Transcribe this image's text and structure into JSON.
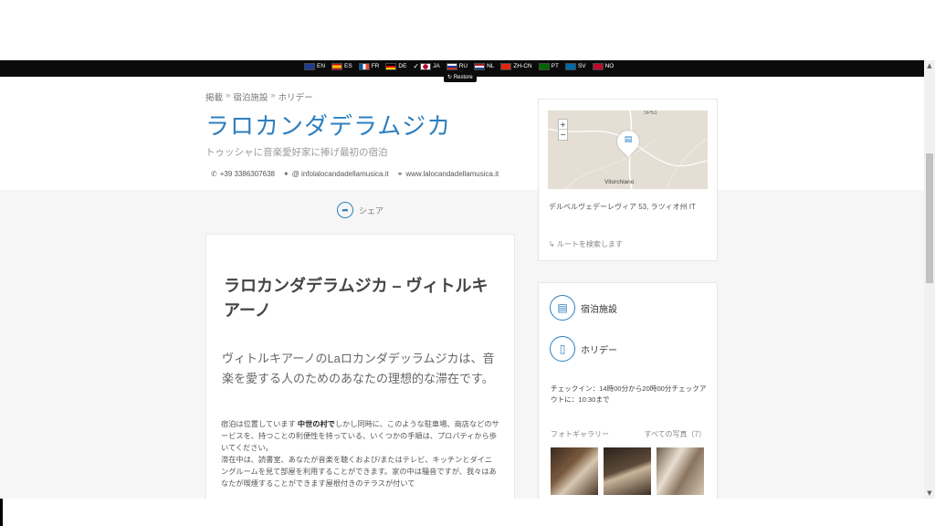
{
  "lang_bar": {
    "languages": [
      {
        "code": "EN",
        "color": "#1f3b8f"
      },
      {
        "code": "ES",
        "color": "#c60b1e"
      },
      {
        "code": "FR",
        "color": "#0055a4"
      },
      {
        "code": "DE",
        "color": "#000000"
      },
      {
        "code": "JA",
        "color": "#ffffff",
        "active": true
      },
      {
        "code": "RU",
        "color": "#ffffff"
      },
      {
        "code": "NL",
        "color": "#21468b"
      },
      {
        "code": "ZH-CN",
        "color": "#de2910"
      },
      {
        "code": "PT",
        "color": "#006600"
      },
      {
        "code": "SV",
        "color": "#006aa7"
      },
      {
        "code": "NO",
        "color": "#ba0c2f"
      }
    ],
    "restore_label": "↻ Restore"
  },
  "breadcrumb": [
    "掲載",
    "宿泊施設",
    "ホリデー"
  ],
  "breadcrumb_sep": "»",
  "title": "ラロカンダデラムジカ",
  "subtitle": "トゥッシャに音楽愛好家に捧げ最初の宿泊",
  "contacts": {
    "phone": "+39 3386307638",
    "email": "@ infolalocandadellamusica.it",
    "website": "www.lalocandadellamusica.it"
  },
  "share_label": "シェア",
  "main": {
    "heading": "ラロカンダデラムジカ – ヴィトルキアーノ",
    "lead": "ヴィトルキアーノのLaロカンダデッラムジカは、音楽を愛する人のためのあなたの理想的な滞在です。",
    "body_1a": "宿泊は位置しています ",
    "body_1b": "中世の村で",
    "body_1c": "しかし同時に、このような駐車場、商店などのサービスを、持つことの利便性を持っている、いくつかの手順は、プロパティから歩いてください。",
    "body_2": "滞在中は、読書室、あなたが音楽を聴くおよび/またはテレビ、キッチンとダイニングルームを見て部屋を利用することができます。家の中は騒音ですが、我々はあなたが喫煙することができます屋根付きのテラスが付いて"
  },
  "map_card": {
    "zoom_in": "+",
    "zoom_out": "−",
    "town_label": "Vitorchiano",
    "road_label": "SP51",
    "address": "デルベルヴェデーレヴィア 53, ラツィオ州 IT",
    "route_label": "↳ ルートを検索します"
  },
  "info_card": {
    "category_1": "宿泊施設",
    "category_2": "ホリデー",
    "checkin": "チェックイン：14時00分から20時00分チェックアウトに：10:30まで",
    "gallery_label": "フォトギャラリー",
    "all_photos": "すべての写真（7）"
  }
}
